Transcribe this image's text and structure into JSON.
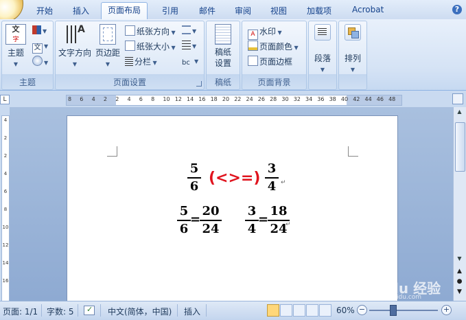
{
  "tabs": [
    {
      "label": "开始",
      "active": false
    },
    {
      "label": "插入",
      "active": false
    },
    {
      "label": "页面布局",
      "active": true
    },
    {
      "label": "引用",
      "active": false
    },
    {
      "label": "邮件",
      "active": false
    },
    {
      "label": "审阅",
      "active": false
    },
    {
      "label": "视图",
      "active": false
    },
    {
      "label": "加载项",
      "active": false
    },
    {
      "label": "Acrobat",
      "active": false
    }
  ],
  "ribbon": {
    "theme_group": {
      "label": "主题",
      "theme_button": "主题"
    },
    "page_setup_group": {
      "label": "页面设置",
      "text_direction": "文字方向",
      "margins": "页边距",
      "orientation": "纸张方向",
      "size": "纸张大小",
      "columns": "分栏"
    },
    "draft_group": {
      "label": "稿纸",
      "draft_setup": "稿纸设置"
    },
    "background_group": {
      "label": "页面背景",
      "watermark": "水印",
      "page_color": "页面颜色",
      "page_borders": "页面边框"
    },
    "paragraph_button": "段落",
    "arrange_button": "排列"
  },
  "ruler": {
    "corner": "L",
    "ticks": [
      "8",
      "6",
      "4",
      "2",
      "2",
      "4",
      "6",
      "8",
      "10",
      "12",
      "14",
      "16",
      "18",
      "20",
      "22",
      "24",
      "26",
      "28",
      "30",
      "32",
      "34",
      "36",
      "38",
      "40",
      "42",
      "44",
      "46",
      "48"
    ],
    "vticks": [
      "4",
      "2",
      "2",
      "4",
      "6",
      "8",
      "10",
      "12",
      "14",
      "16"
    ]
  },
  "document": {
    "line1": {
      "left_num": "5",
      "left_den": "6",
      "compare": "(<>=)",
      "right_num": "3",
      "right_den": "4"
    },
    "line2": {
      "a_num": "5",
      "a_den": "6",
      "eq1": "=",
      "b_num": "20",
      "b_den": "24",
      "c_num": "3",
      "c_den": "4",
      "eq2": "=",
      "d_num": "18",
      "d_den": "24"
    },
    "para_mark": "↵"
  },
  "statusbar": {
    "page": "页面: 1/1",
    "words": "字数: 5",
    "language": "中文(简体，中国)",
    "insert_mode": "插入",
    "zoom": "60%",
    "zoom_out": "−",
    "zoom_in": "+"
  },
  "watermark": {
    "logo": "Baidu 经验",
    "url": "jingyan.baidu.com"
  }
}
